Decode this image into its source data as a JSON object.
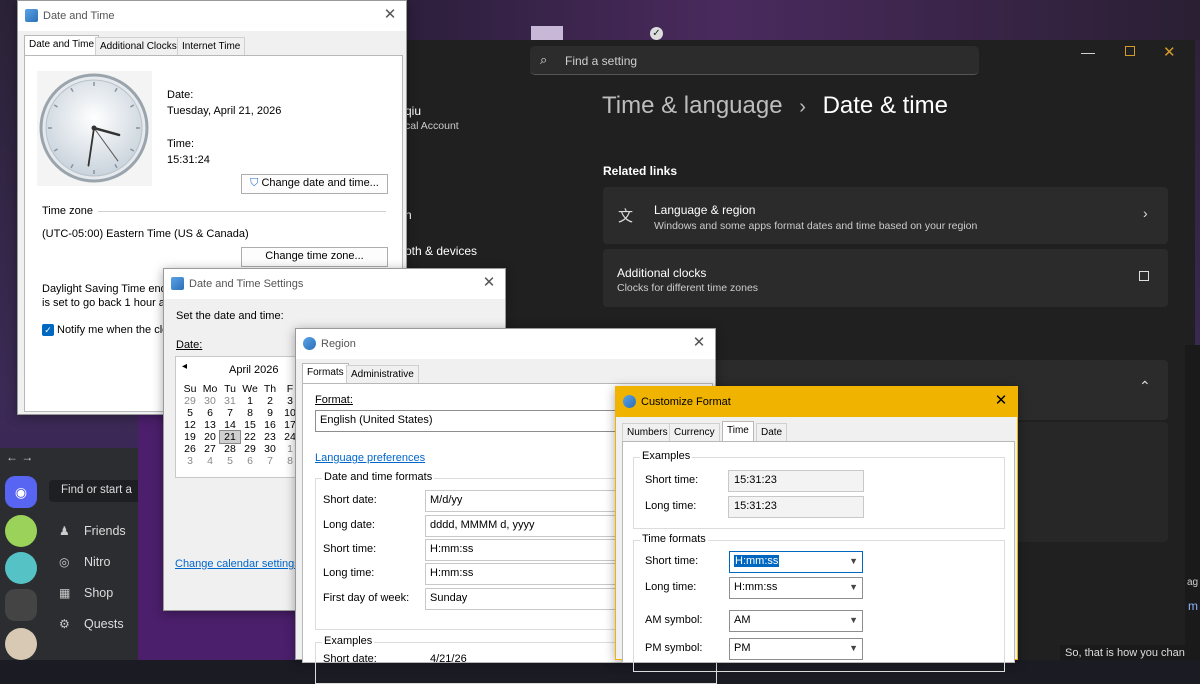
{
  "settings": {
    "search_placeholder": "Find a setting",
    "breadcrumb_parent": "Time & language",
    "breadcrumb_sep": "›",
    "breadcrumb_current": "Date & time",
    "account_name_partial": "qiu",
    "account_type_partial": "cal Account",
    "nav_partial_bluetooth": "oth & devices",
    "nav_partial_n": "n",
    "related_links": "Related links",
    "language_region_title": "Language & region",
    "language_region_desc": "Windows and some apps format dates and time based on your region",
    "additional_clocks_title": "Additional clocks",
    "additional_clocks_desc": "Clocks for different time zones",
    "edge_ag": "ag",
    "edge_m": "m",
    "bottom_right_text": "So, that is how you chan"
  },
  "date_time": {
    "title": "Date and Time",
    "tabs": [
      "Date and Time",
      "Additional Clocks",
      "Internet Time"
    ],
    "date_label": "Date:",
    "date_value": "Tuesday, April 21, 2026",
    "time_label": "Time:",
    "time_value": "15:31:24",
    "change_date_btn": "Change date and time...",
    "time_zone_label": "Time zone",
    "time_zone_value": "(UTC-05:00) Eastern Time (US & Canada)",
    "change_zone_btn": "Change time zone...",
    "dst_line1": "Daylight Saving Time ends",
    "dst_line2": "is set to go back 1 hour at",
    "notify_label": "Notify me when the clo"
  },
  "dt_settings": {
    "title": "Date and Time Settings",
    "set_label": "Set the date and time:",
    "date_label": "Date:",
    "month": "April 2026",
    "prev": "◂",
    "weekdays": [
      "Su",
      "Mo",
      "Tu",
      "We",
      "Th",
      "F"
    ],
    "weeks": [
      [
        "29",
        "30",
        "31",
        "1",
        "2",
        "3"
      ],
      [
        "5",
        "6",
        "7",
        "8",
        "9",
        "10"
      ],
      [
        "12",
        "13",
        "14",
        "15",
        "16",
        "17"
      ],
      [
        "19",
        "20",
        "21",
        "22",
        "23",
        "24"
      ],
      [
        "26",
        "27",
        "28",
        "29",
        "30",
        "1"
      ],
      [
        "3",
        "4",
        "5",
        "6",
        "7",
        "8"
      ]
    ],
    "change_calendar_link": "Change calendar settings"
  },
  "region": {
    "title": "Region",
    "tabs": [
      "Formats",
      "Administrative"
    ],
    "format_label": "Format:",
    "format_value": "English (United States)",
    "lang_pref_link": "Language preferences",
    "dt_formats_label": "Date and time formats",
    "short_date_label": "Short date:",
    "short_date_value": "M/d/yy",
    "long_date_label": "Long date:",
    "long_date_value": "dddd, MMMM d, yyyy",
    "short_time_label": "Short time:",
    "short_time_value": "H:mm:ss",
    "long_time_label": "Long time:",
    "long_time_value": "H:mm:ss",
    "first_day_label": "First day of week:",
    "first_day_value": "Sunday",
    "examples_label": "Examples",
    "ex_short_date_label": "Short date:",
    "ex_short_date_value": "4/21/26"
  },
  "customize": {
    "title": "Customize Format",
    "tabs": [
      "Numbers",
      "Currency",
      "Time",
      "Date"
    ],
    "examples_label": "Examples",
    "short_time_label": "Short time:",
    "short_time_example": "15:31:23",
    "long_time_label": "Long time:",
    "long_time_example": "15:31:23",
    "time_formats_label": "Time formats",
    "fmt_short_time_label": "Short time:",
    "fmt_short_time_value": "H:mm:ss",
    "fmt_long_time_label": "Long time:",
    "fmt_long_time_value": "H:mm:ss",
    "am_label": "AM symbol:",
    "am_value": "AM",
    "pm_label": "PM symbol:",
    "pm_value": "PM"
  },
  "discord": {
    "search_partial": "Find or start a",
    "nav": [
      "Friends",
      "Nitro",
      "Shop",
      "Quests"
    ]
  },
  "clock": {
    "hour": 3,
    "minute": 31,
    "second": 24
  }
}
